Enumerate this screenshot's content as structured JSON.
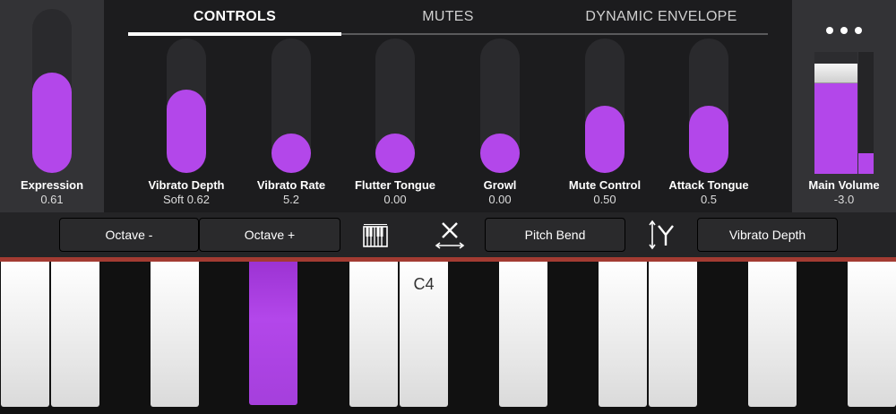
{
  "tabs": [
    {
      "label": "CONTROLS",
      "active": true
    },
    {
      "label": "MUTES",
      "active": false
    },
    {
      "label": "DYNAMIC ENVELOPE",
      "active": false
    }
  ],
  "expression": {
    "label": "Expression",
    "value": "0.61",
    "level": 0.61
  },
  "controls": [
    {
      "label": "Vibrato Depth",
      "value": "Soft 0.62",
      "level": 0.62
    },
    {
      "label": "Vibrato Rate",
      "value": "5.2",
      "level": 0.0
    },
    {
      "label": "Flutter Tongue",
      "value": "0.00",
      "level": 0.0
    },
    {
      "label": "Growl",
      "value": "0.00",
      "level": 0.0
    },
    {
      "label": "Mute Control",
      "value": "0.50",
      "level": 0.5
    },
    {
      "label": "Attack Tongue",
      "value": "0.5",
      "level": 0.5
    }
  ],
  "main_volume": {
    "label": "Main Volume",
    "value": "-3.0",
    "level": 0.9,
    "meter_level": 0.17
  },
  "toolbar": {
    "octave_down": "Octave -",
    "octave_up": "Octave +",
    "x_axis_assignment": "Pitch Bend",
    "y_axis_assignment": "Vibrato Depth"
  },
  "icons": {
    "more": "more-horizontal-icon",
    "keyboard": "piano-keys-icon",
    "x_axis": "x-axis-icon",
    "y_axis": "y-axis-icon"
  },
  "keyboard": {
    "note_label": "C4",
    "active_note_color": "#b347ea"
  },
  "colors": {
    "accent": "#b347ea",
    "divider": "#a33b32"
  }
}
